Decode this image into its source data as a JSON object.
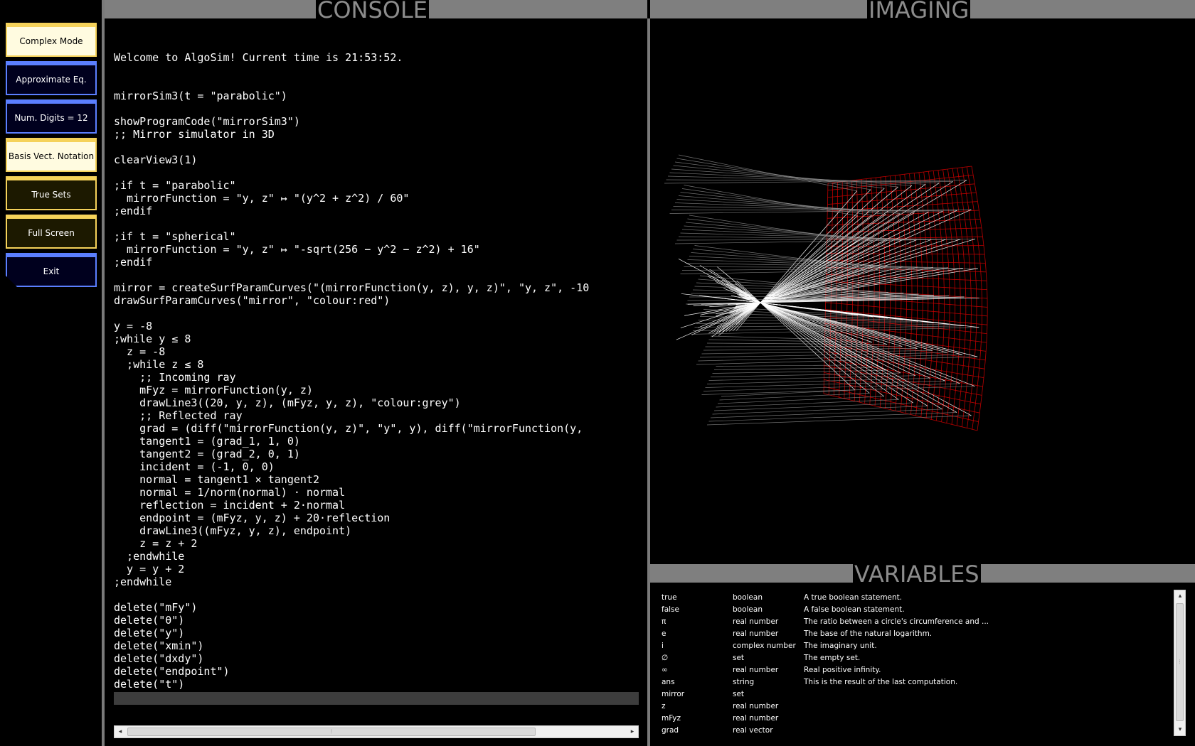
{
  "sidebar": {
    "buttons": [
      {
        "label": "Complex Mode",
        "style": "yellow-light"
      },
      {
        "label": "Approximate Eq.",
        "style": "blue"
      },
      {
        "label": "Num. Digits = 12",
        "style": "blue"
      },
      {
        "label": "Basis Vect. Notation",
        "style": "yellow-light"
      },
      {
        "label": "True Sets",
        "style": "yellow-dark"
      },
      {
        "label": "Full Screen",
        "style": "yellow-dark"
      },
      {
        "label": "Exit",
        "style": "blue"
      }
    ]
  },
  "panels": {
    "console": "CONSOLE",
    "imaging": "IMAGING",
    "variables": "VARIABLES"
  },
  "console": {
    "lines": [
      "",
      "Welcome to AlgoSim! Current time is 21:53:52.",
      "",
      "",
      "mirrorSim3(t = \"parabolic\")",
      "",
      "showProgramCode(\"mirrorSim3\")",
      ";; Mirror simulator in 3D",
      "",
      "clearView3(1)",
      "",
      ";if t = \"parabolic\"",
      "  mirrorFunction = \"y, z\" ↦ \"(y^2 + z^2) / 60\"",
      ";endif",
      "",
      ";if t = \"spherical\"",
      "  mirrorFunction = \"y, z\" ↦ \"-sqrt(256 − y^2 − z^2) + 16\"",
      ";endif",
      "",
      "mirror = createSurfParamCurves(\"(mirrorFunction(y, z), y, z)\", \"y, z\", -10",
      "drawSurfParamCurves(\"mirror\", \"colour:red\")",
      "",
      "y = -8",
      ";while y ≤ 8",
      "  z = -8",
      "  ;while z ≤ 8",
      "    ;; Incoming ray",
      "    mFyz = mirrorFunction(y, z)",
      "    drawLine3((20, y, z), (mFyz, y, z), \"colour:grey\")",
      "    ;; Reflected ray",
      "    grad = (diff(\"mirrorFunction(y, z)\", \"y\", y), diff(\"mirrorFunction(y,",
      "    tangent1 = (grad_1, 1, 0)",
      "    tangent2 = (grad_2, 0, 1)",
      "    incident = (-1, 0, 0)",
      "    normal = tangent1 × tangent2",
      "    normal = 1/norm(normal) · normal",
      "    reflection = incident + 2·normal",
      "    endpoint = (mFyz, y, z) + 20·reflection",
      "    drawLine3((mFyz, y, z), endpoint)",
      "    z = z + 2",
      "  ;endwhile",
      "  y = y + 2",
      ";endwhile",
      "",
      "delete(\"mFy\")",
      "delete(\"θ\")",
      "delete(\"y\")",
      "delete(\"xmin\")",
      "delete(\"dxdy\")",
      "delete(\"endpoint\")",
      "delete(\"t\")"
    ],
    "input_value": ""
  },
  "scrollbars": {
    "left_arrow": "◂",
    "right_arrow": "▸",
    "up_arrow": "▴",
    "down_arrow": "▾",
    "grip": "⦙"
  },
  "imaging": {
    "mirror_colour": "#cc0000",
    "incoming_colour": "#8c8c8c",
    "reflected_colour": "#ffffff"
  },
  "variables": [
    {
      "name": "true",
      "type": "boolean",
      "desc": "A true boolean statement."
    },
    {
      "name": "false",
      "type": "boolean",
      "desc": "A false boolean statement."
    },
    {
      "name": "π",
      "type": "real number",
      "desc": "The ratio between a circle's circumference and ..."
    },
    {
      "name": "e",
      "type": "real number",
      "desc": "The base of the natural logarithm."
    },
    {
      "name": "i",
      "type": "complex number",
      "desc": "The imaginary unit."
    },
    {
      "name": "∅",
      "type": "set",
      "desc": "The empty set."
    },
    {
      "name": "∞",
      "type": "real number",
      "desc": "Real positive infinity."
    },
    {
      "name": "ans",
      "type": "string",
      "desc": "This is the result of the last computation."
    },
    {
      "name": "mirror",
      "type": "set",
      "desc": ""
    },
    {
      "name": "z",
      "type": "real number",
      "desc": ""
    },
    {
      "name": "mFyz",
      "type": "real number",
      "desc": ""
    },
    {
      "name": "grad",
      "type": "real vector",
      "desc": ""
    }
  ]
}
